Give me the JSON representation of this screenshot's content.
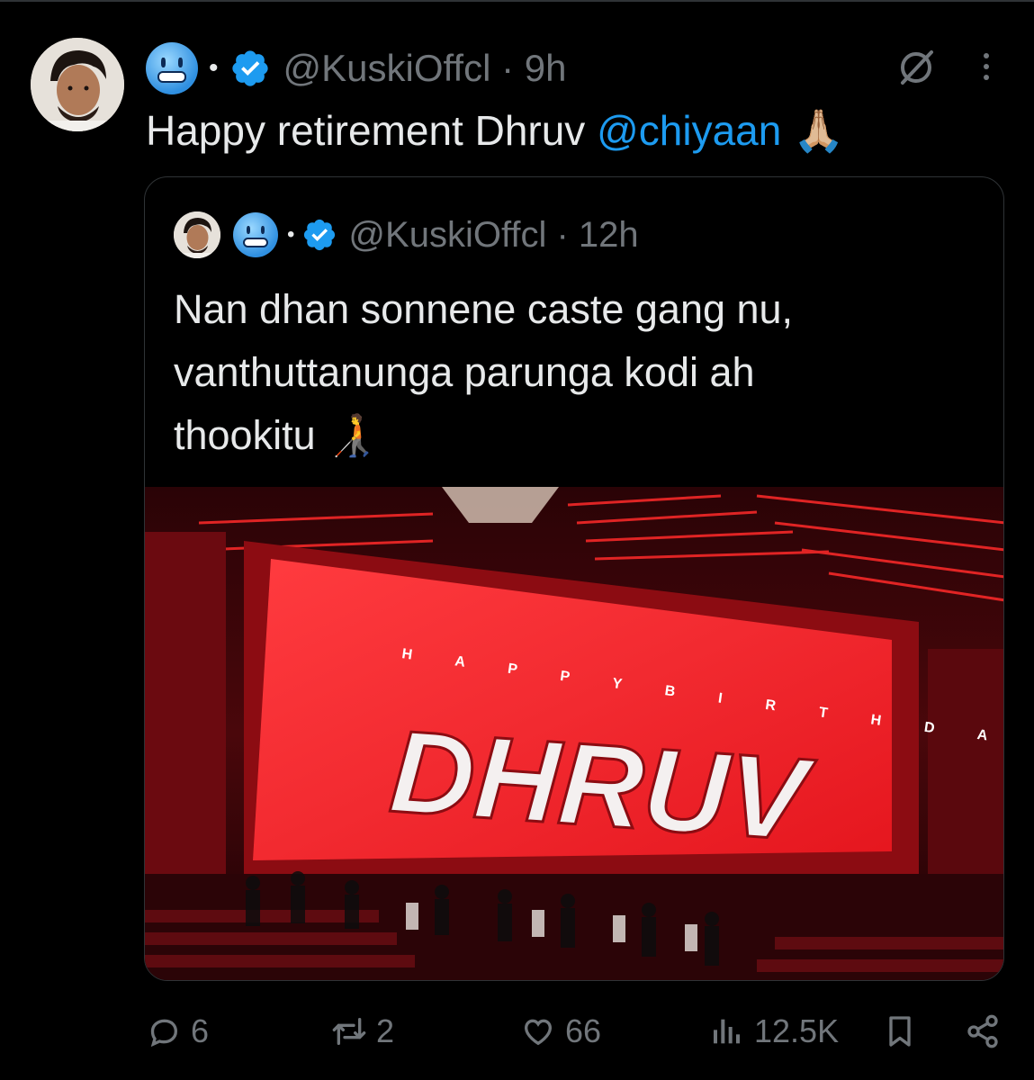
{
  "tweet": {
    "handle": "@KuskiOffcl",
    "time": "9h",
    "text_prefix": "Happy retirement Dhruv ",
    "mention": "@chiyaan",
    "emoji": "🙏🏼",
    "name_emoji": "cold-face-emoji",
    "separator": "•",
    "time_separator": " · "
  },
  "quoted": {
    "handle": "@KuskiOffcl",
    "time": "12h",
    "lines": [
      "Nan dhan sonnene caste gang nu,",
      "vanthuttanunga parunga kodi ah",
      "thookitu 🧑‍🦯"
    ],
    "media": {
      "screen_top": "H A P P Y   B I R T H D A Y",
      "screen_title": "DHRUV"
    }
  },
  "actions": {
    "replies": "6",
    "reposts": "2",
    "likes": "66",
    "views": "12.5K"
  },
  "colors": {
    "background": "#000000",
    "text": "#e7e9ea",
    "muted": "#71767b",
    "accent": "#1d9bf0",
    "border": "#2f3336"
  },
  "icons": [
    "grok-icon",
    "more-icon",
    "verified-badge-icon",
    "reply-icon",
    "repost-icon",
    "like-icon",
    "views-icon",
    "bookmark-icon",
    "share-icon"
  ]
}
